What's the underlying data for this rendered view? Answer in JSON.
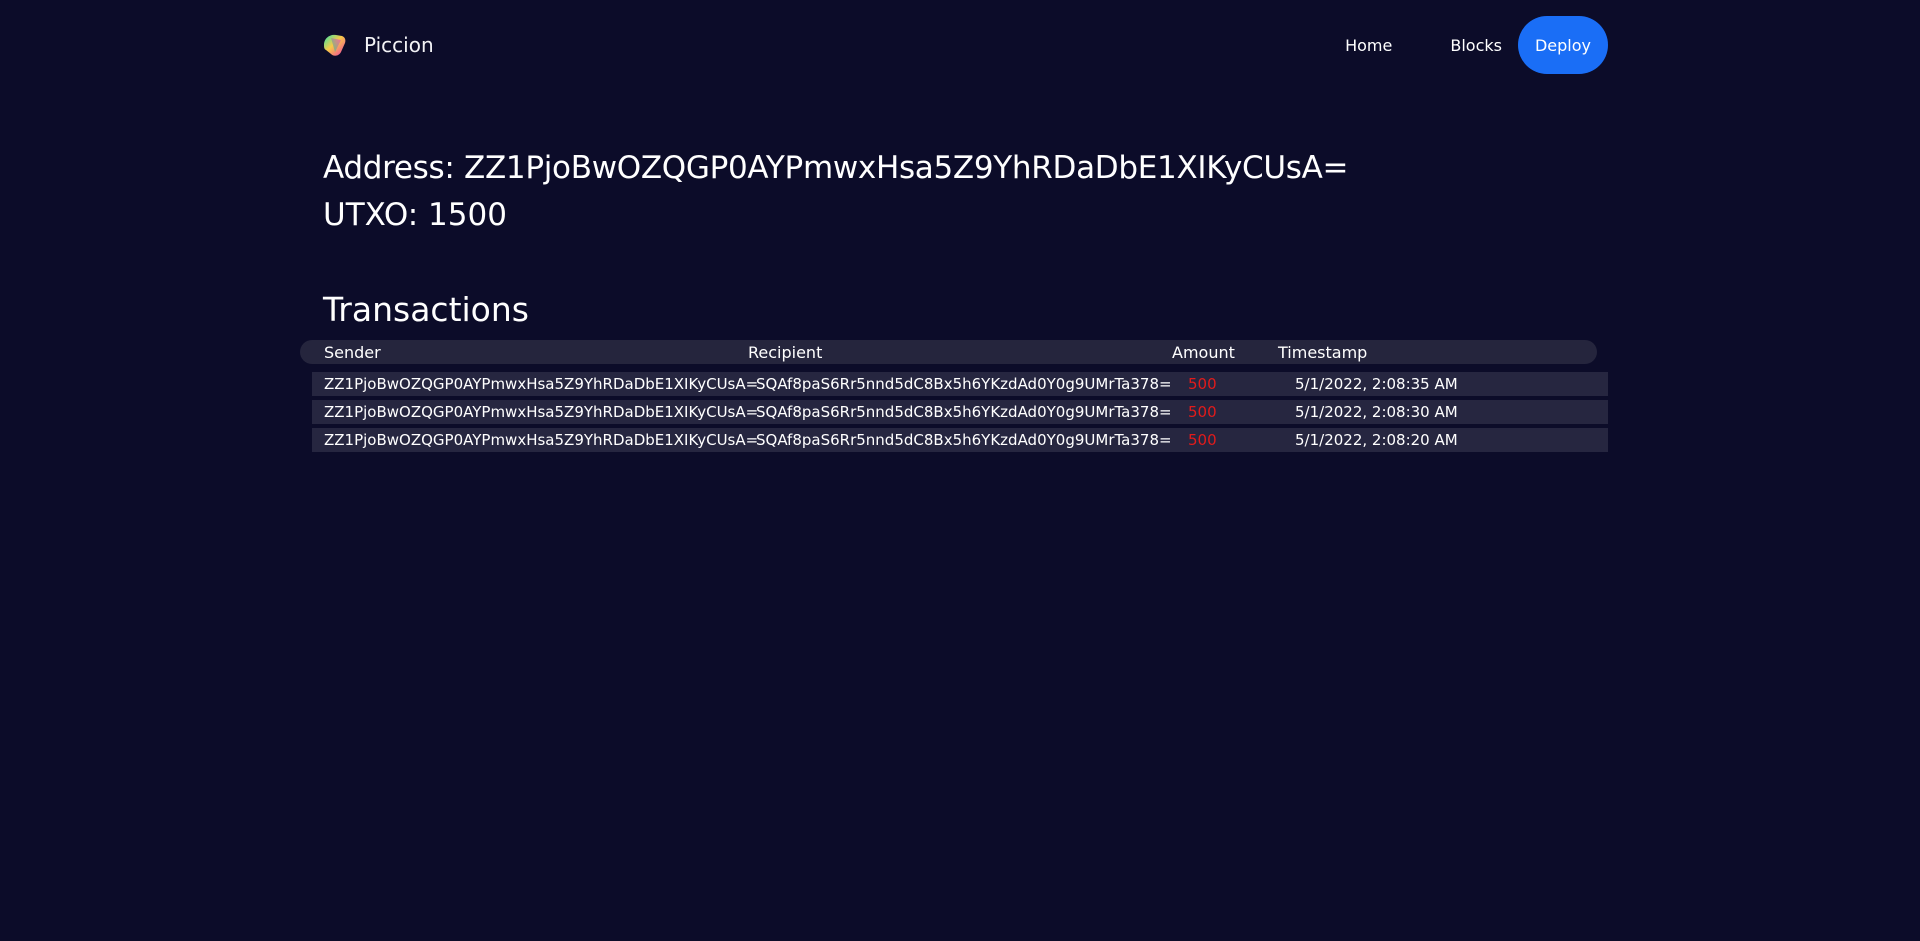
{
  "nav": {
    "brand": "Piccion",
    "links": [
      "Home",
      "Blocks"
    ],
    "deploy_label": "Deploy"
  },
  "account": {
    "address_label": "Address: ZZ1PjoBwOZQGP0AYPmwxHsa5Z9YhRDaDbE1XIKyCUsA=",
    "utxo_label": "UTXO: 1500"
  },
  "transactions": {
    "title": "Transactions",
    "columns": [
      "Sender",
      "Recipient",
      "Amount",
      "Timestamp"
    ],
    "rows": [
      {
        "sender": "ZZ1PjoBwOZQGP0AYPmwxHsa5Z9YhRDaDbE1XIKyCUsA=",
        "recipient": "SQAf8paS6Rr5nnd5dC8Bx5h6YKzdAd0Y0g9UMrTa378=",
        "amount": "500",
        "timestamp": "5/1/2022, 2:08:35 AM"
      },
      {
        "sender": "ZZ1PjoBwOZQGP0AYPmwxHsa5Z9YhRDaDbE1XIKyCUsA=",
        "recipient": "SQAf8paS6Rr5nnd5dC8Bx5h6YKzdAd0Y0g9UMrTa378=",
        "amount": "500",
        "timestamp": "5/1/2022, 2:08:30 AM"
      },
      {
        "sender": "ZZ1PjoBwOZQGP0AYPmwxHsa5Z9YhRDaDbE1XIKyCUsA=",
        "recipient": "SQAf8paS6Rr5nnd5dC8Bx5h6YKzdAd0Y0g9UMrTa378=",
        "amount": "500",
        "timestamp": "5/1/2022, 2:08:20 AM"
      }
    ]
  },
  "colors": {
    "background": "#0c0c29",
    "accent": "#1a6ef6",
    "row_background": "#262640",
    "amount_negative": "#e11b1b"
  },
  "icons": {
    "logo": "gradient-triangle-logo-icon"
  }
}
